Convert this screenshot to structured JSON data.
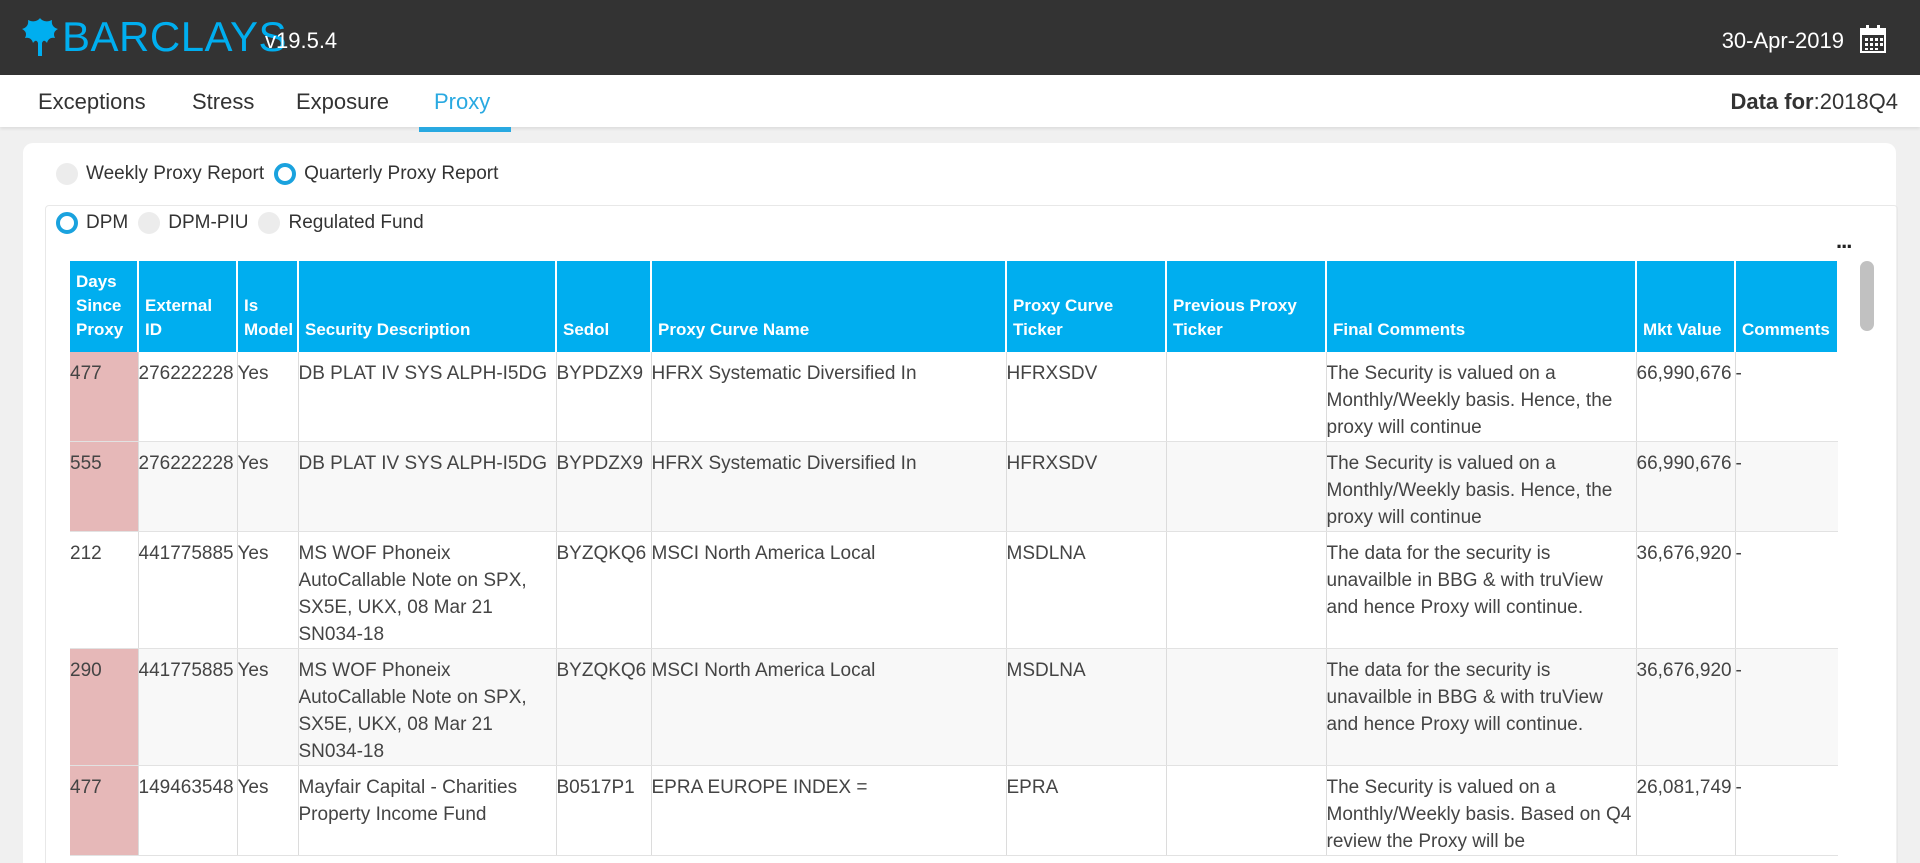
{
  "header": {
    "brand": "BARCLAYS",
    "version": "v19.5.4",
    "date": "30-Apr-2019"
  },
  "nav": {
    "tabs": [
      {
        "label": "Exceptions"
      },
      {
        "label": "Stress"
      },
      {
        "label": "Exposure"
      },
      {
        "label": "Proxy"
      }
    ],
    "active_tab": "Proxy",
    "data_for_label": "Data for",
    "data_for_value": ":2018Q4"
  },
  "report_type": {
    "options": [
      "Weekly Proxy Report",
      "Quarterly Proxy Report"
    ],
    "selected": "Quarterly Proxy Report"
  },
  "fund_type": {
    "options": [
      "DPM",
      "DPM-PIU",
      "Regulated Fund"
    ],
    "selected": "DPM"
  },
  "more_label": "...",
  "table": {
    "columns": [
      "Days Since Proxy",
      "External ID",
      "Is Model",
      "Security Description",
      "Sedol",
      "Proxy Curve Name",
      "Proxy Curve Ticker",
      "Previous Proxy Ticker",
      "Final Comments",
      "Mkt Value",
      "Comments"
    ],
    "rows": [
      {
        "days": "477",
        "ext_id": "276222228",
        "is_model": "Yes",
        "desc": "DB PLAT IV SYS ALPH-I5DG",
        "sedol": "BYPDZX9",
        "curve_name": "HFRX Systematic Diversified In",
        "curve_ticker": "HFRXSDV",
        "prev_ticker": "",
        "final_comments": "The Security is valued on a Monthly/Weekly basis. Hence, the proxy will continue",
        "mkt_value": "66,990,676",
        "comments": "-",
        "flag": true
      },
      {
        "days": "555",
        "ext_id": "276222228",
        "is_model": "Yes",
        "desc": "DB PLAT IV SYS ALPH-I5DG",
        "sedol": "BYPDZX9",
        "curve_name": "HFRX Systematic Diversified In",
        "curve_ticker": "HFRXSDV",
        "prev_ticker": "",
        "final_comments": "The Security is valued on a Monthly/Weekly basis. Hence, the proxy will continue",
        "mkt_value": "66,990,676",
        "comments": "-",
        "flag": true
      },
      {
        "days": "212",
        "ext_id": "441775885",
        "is_model": "Yes",
        "desc": "MS WOF Phoneix AutoCallable Note on SPX, SX5E, UKX, 08 Mar 21 SN034-18",
        "sedol": "BYZQKQ6",
        "curve_name": "MSCI North America Local",
        "curve_ticker": "MSDLNA",
        "prev_ticker": "",
        "final_comments": "The data for the security is unavailble in BBG & with truView and hence Proxy will continue.",
        "mkt_value": "36,676,920",
        "comments": "-",
        "flag": false
      },
      {
        "days": "290",
        "ext_id": "441775885",
        "is_model": "Yes",
        "desc": "MS WOF Phoneix AutoCallable Note on SPX, SX5E, UKX, 08 Mar 21 SN034-18",
        "sedol": "BYZQKQ6",
        "curve_name": "MSCI North America Local",
        "curve_ticker": "MSDLNA",
        "prev_ticker": "",
        "final_comments": "The data for the security is unavailble in BBG & with truView and hence Proxy will continue.",
        "mkt_value": "36,676,920",
        "comments": "-",
        "flag": true
      },
      {
        "days": "477",
        "ext_id": "149463548",
        "is_model": "Yes",
        "desc": "Mayfair Capital - Charities Property Income Fund",
        "sedol": "B0517P1",
        "curve_name": "EPRA EUROPE INDEX =",
        "curve_ticker": "EPRA",
        "prev_ticker": "",
        "final_comments": "The Security is valued on a Monthly/Weekly basis. Based on Q4 review the Proxy will be",
        "mkt_value": "26,081,749",
        "comments": "-",
        "flag": true
      }
    ]
  }
}
